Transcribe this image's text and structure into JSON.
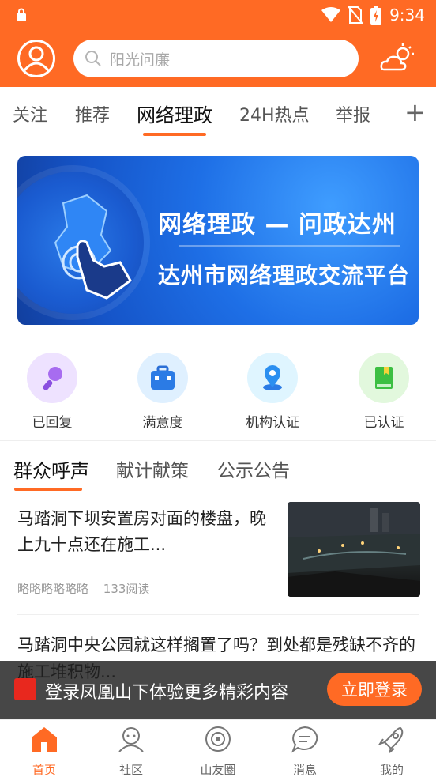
{
  "status_bar": {
    "time": "9:34"
  },
  "header": {
    "search_placeholder": "阳光问廉"
  },
  "channels": {
    "items": [
      "关注",
      "推荐",
      "网络理政",
      "24H热点",
      "举报"
    ],
    "active_index": 2,
    "add_glyph": "+"
  },
  "banner": {
    "title": "网络理政 — 问政达州",
    "subtitle": "达州市网络理政交流平台"
  },
  "quick_actions": [
    {
      "label": "已回复",
      "icon": "microphone-icon"
    },
    {
      "label": "满意度",
      "icon": "briefcase-icon"
    },
    {
      "label": "机构认证",
      "icon": "location-pin-icon"
    },
    {
      "label": "已认证",
      "icon": "book-icon"
    }
  ],
  "sub_tabs": {
    "items": [
      "群众呼声",
      "献计献策",
      "公示公告"
    ],
    "active_index": 0
  },
  "news": [
    {
      "title": "马踏洞下坝安置房对面的楼盘，晚上九十点还在施工...",
      "author": "略略略略略略",
      "reads": "133阅读"
    },
    {
      "title": "马踏洞中央公园就这样搁置了吗？到处都是残缺不齐的施工堆积物..."
    }
  ],
  "login_banner": {
    "text": "登录凤凰山下体验更多精彩内容",
    "button": "立即登录"
  },
  "bottom_nav": {
    "items": [
      {
        "label": "首页",
        "icon": "home-icon"
      },
      {
        "label": "社区",
        "icon": "community-icon"
      },
      {
        "label": "山友圈",
        "icon": "circle-icon"
      },
      {
        "label": "消息",
        "icon": "message-icon"
      },
      {
        "label": "我的",
        "icon": "rocket-icon"
      }
    ],
    "active_index": 0
  },
  "colors": {
    "accent": "#ff6a24",
    "banner_blue": "#1e6fe6"
  }
}
